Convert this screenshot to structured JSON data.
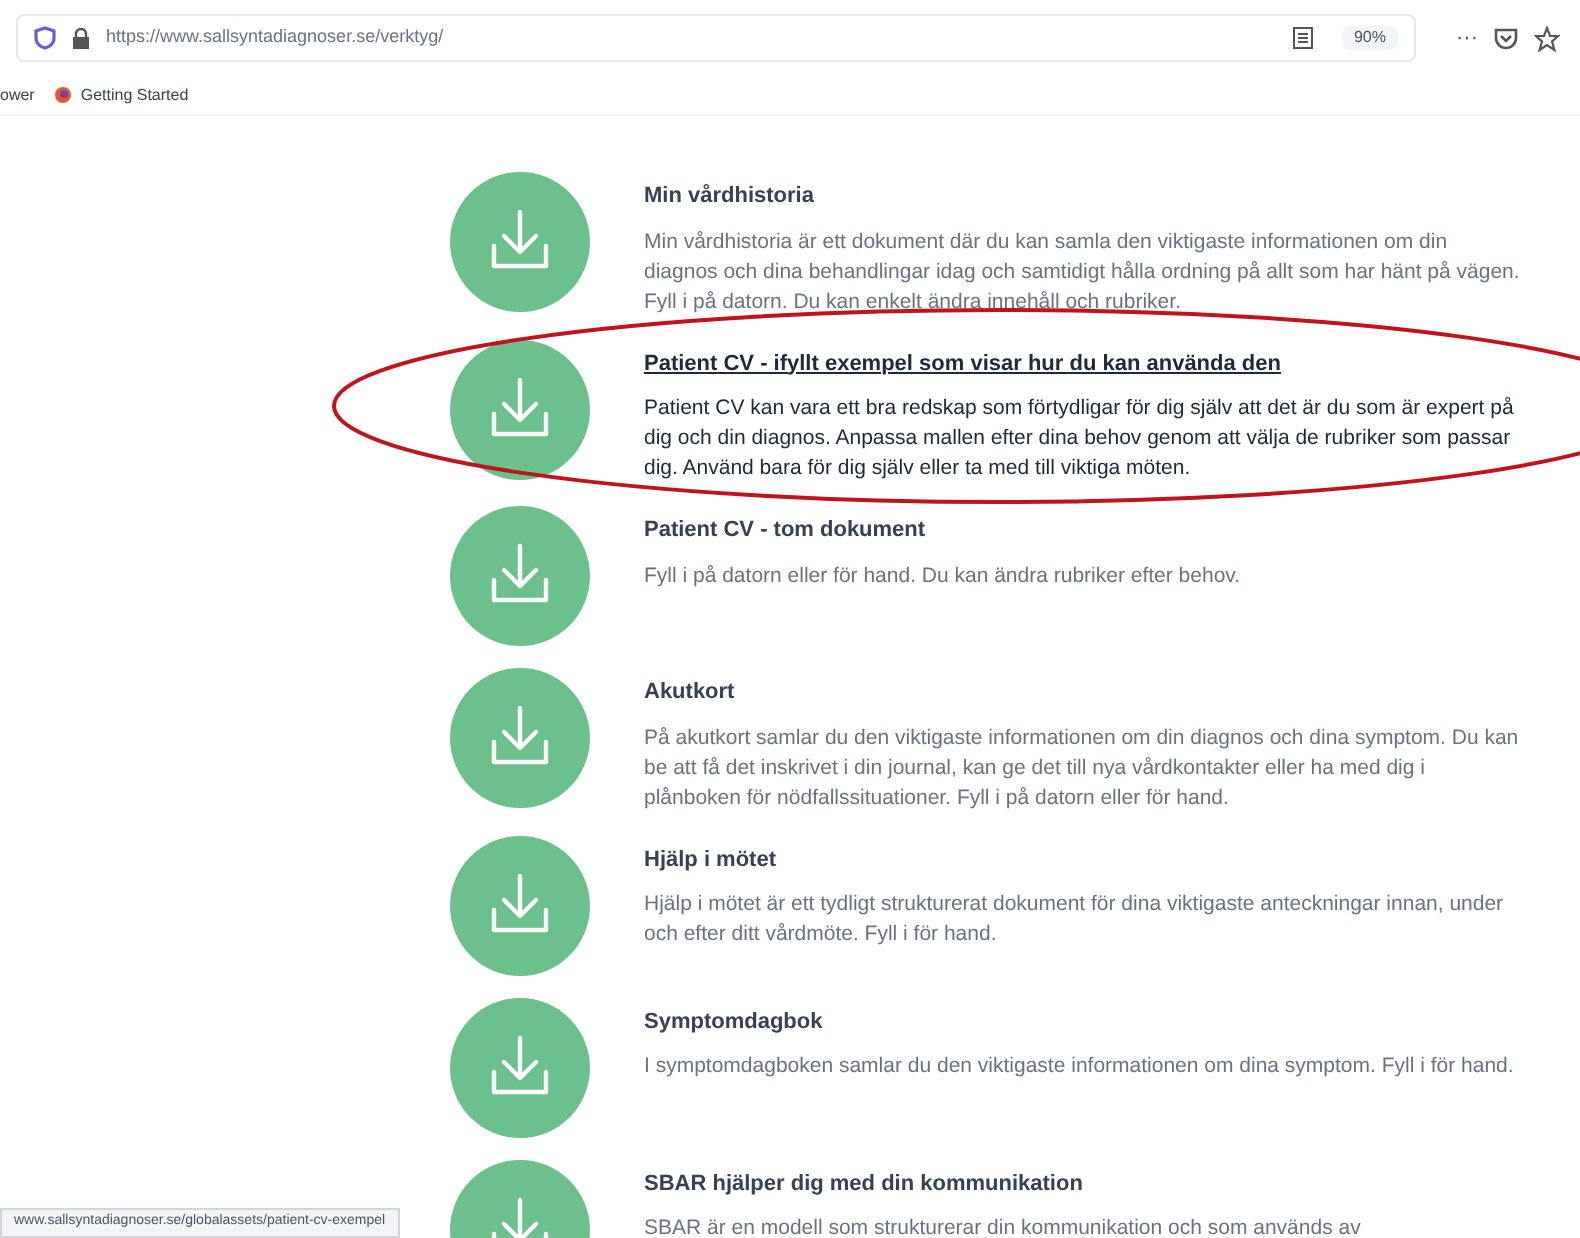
{
  "browser": {
    "url": "https://www.sallsyntadiagnoser.se/verktyg/",
    "zoom": "90%",
    "menu": "···",
    "bookmarks": [
      {
        "label": "ower"
      },
      {
        "label": "Getting Started"
      }
    ]
  },
  "items": [
    {
      "title": "Min vårdhistoria",
      "link": false,
      "text": "Min vårdhistoria är ett dokument där du kan samla den viktigaste informationen om din diagnos och dina behandlingar idag och samtidigt hålla ordning på allt som har hänt på vägen. Fyll i på datorn. Du kan enkelt ändra innehåll och rubriker."
    },
    {
      "title": "Patient CV - ifyllt exempel som visar hur du kan använda den",
      "link": true,
      "text": "Patient CV kan vara ett bra redskap som förtydligar för dig själv att det är du som är expert på dig och din diagnos. Anpassa mallen efter dina behov genom att välja de rubriker som passar dig. Använd bara för dig själv eller ta med till viktiga möten."
    },
    {
      "title": "Patient CV - tom dokument",
      "link": false,
      "text": "Fyll i på datorn eller för hand. Du kan ändra rubriker efter behov."
    },
    {
      "title": "Akutkort",
      "link": false,
      "text": "På akutkort samlar du den viktigaste informationen om din diagnos och dina symptom. Du kan be att få det inskrivet i din journal, kan ge det till nya vårdkontakter eller ha med dig i plånboken för nödfallssituationer. Fyll i på datorn eller för hand."
    },
    {
      "title": "Hjälp i mötet",
      "link": false,
      "text": "Hjälp i mötet är ett tydligt strukturerat dokument för dina viktigaste anteckningar innan, under och efter ditt vårdmöte. Fyll i för hand."
    },
    {
      "title": "Symptomdagbok",
      "link": false,
      "text": "I symptomdagboken samlar du den viktigaste informationen om dina symptom. Fyll i för hand."
    },
    {
      "title": "SBAR hjälper dig med din kommunikation",
      "link": false,
      "text": "SBAR är en modell som strukturerar din kommunikation och som används av"
    }
  ],
  "status_bar": {
    "text": "www.sallsyntadiagnoser.se/globalassets/patient-cv-exempel"
  }
}
